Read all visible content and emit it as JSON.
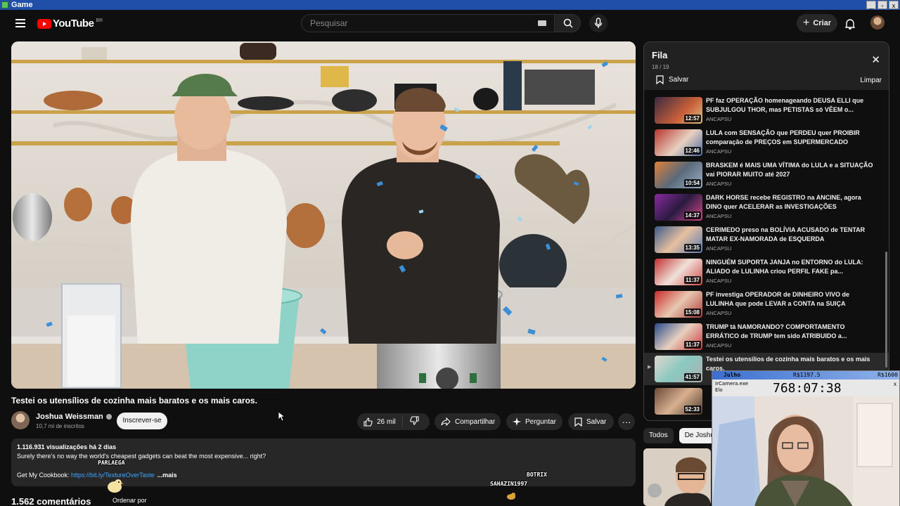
{
  "window": {
    "title": "Game",
    "controls": [
      "_",
      "▫",
      "x"
    ]
  },
  "header": {
    "logo_text": "YouTube",
    "region": "BR",
    "search_placeholder": "Pesquisar",
    "create_label": "Criar"
  },
  "video": {
    "title": "Testei os utensílios de cozinha mais baratos e os mais caros.",
    "channel": "Joshua Weissman",
    "subscribers": "10,7 mi de inscritos",
    "subscribe_label": "Inscrever-se",
    "likes": "26 mil",
    "share_label": "Compartilhar",
    "ask_label": "Perguntar",
    "save_label": "Salvar",
    "more_label": "···",
    "views_line": "1.116.931 visualizações  há 2 dias",
    "desc_line1": "Surely there's no way the world's cheapest gadgets can beat the most expensive... right?",
    "desc_cookbook_prefix": "Get My Cookbook: ",
    "desc_link": "https://bit.ly/TextureOverTaste",
    "desc_more": "...mais",
    "comments": "1.562 comentários",
    "sort_label": "Ordenar por"
  },
  "overlay_names": {
    "left": "PARLAEGA",
    "right_top": "BOTRIX",
    "right_bottom": "SAHAZIN1997"
  },
  "queue": {
    "title": "Fila",
    "count": "18 / 19",
    "save_label": "Salvar",
    "clear_label": "Limpar",
    "close": "✕",
    "now_playing_marker": "▶",
    "items": [
      {
        "title": "PF faz OPERAÇÃO homenageando DEUSA ELLI que SUBJULGOU THOR, mas PETISTAS só VÊEM o...",
        "channel": "ANCAPSU",
        "duration": "12:57"
      },
      {
        "title": "LULA com SENSAÇÃO que PERDEU quer PROIBIR comparação de PREÇOS em SUPERMERCADO",
        "channel": "ANCAPSU",
        "duration": "12:46"
      },
      {
        "title": "BRASKEM é MAIS UMA VÍTIMA do LULA e a SITUAÇÃO vai PIORAR MUITO até 2027",
        "channel": "ANCAPSU",
        "duration": "10:54"
      },
      {
        "title": "DARK HORSE recebe REGISTRO na ANCINE, agora DINO quer ACELERAR as INVESTIGAÇÕES",
        "channel": "ANCAPSU",
        "duration": "14:37"
      },
      {
        "title": "CERIMEDO preso na BOLÍVIA ACUSADO de TENTAR MATAR EX-NAMORADA de ESQUERDA",
        "channel": "ANCAPSU",
        "duration": "13:35"
      },
      {
        "title": "NINGUÉM SUPORTA JANJA no ENTORNO do LULA: ALIADO de LULINHA criou PERFIL FAKE pa...",
        "channel": "ANCAPSU",
        "duration": "11:37"
      },
      {
        "title": "PF investiga OPERADOR de DINHEIRO VIVO de LULINHA que pode LEVAR a CONTA na SUIÇA",
        "channel": "ANCAPSU",
        "duration": "15:08"
      },
      {
        "title": "TRUMP tá NAMORANDO? COMPORTAMENTO ERRÁTICO de TRUMP tem sido ATRIBUIDO a...",
        "channel": "ANCAPSU",
        "duration": "11:37"
      },
      {
        "title": "Testei os utensílios de cozinha mais baratos e os mais caros.",
        "channel": "",
        "duration": "41:57"
      },
      {
        "title": "",
        "channel": "",
        "duration": "52:33"
      }
    ]
  },
  "chips": [
    "Todos",
    "De Joshua"
  ],
  "cam": {
    "name": "Julho",
    "money1": "R$1197.5",
    "money2": "R$1600",
    "app_label": "IrCamera.exe",
    "sub_label": "Elo",
    "timer": "768:07:38",
    "close": "x"
  }
}
